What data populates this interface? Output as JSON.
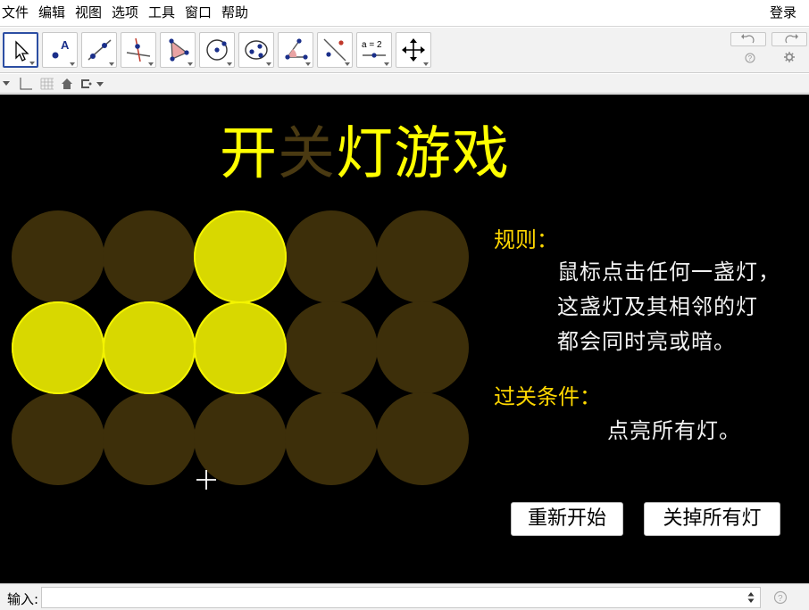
{
  "menubar": {
    "items": [
      "文件",
      "编辑",
      "视图",
      "选项",
      "工具",
      "窗口",
      "帮助"
    ],
    "login": "登录"
  },
  "toolbar": {
    "tools": [
      {
        "name": "move-tool-icon"
      },
      {
        "name": "point-tool-icon",
        "label": "A"
      },
      {
        "name": "line-tool-icon"
      },
      {
        "name": "perpendicular-line-tool-icon"
      },
      {
        "name": "polygon-tool-icon"
      },
      {
        "name": "circle-tool-icon"
      },
      {
        "name": "ellipse-tool-icon"
      },
      {
        "name": "angle-tool-icon"
      },
      {
        "name": "reflect-tool-icon"
      },
      {
        "name": "slider-tool-icon",
        "label": "a = 2"
      },
      {
        "name": "move-view-tool-icon"
      }
    ]
  },
  "canvas": {
    "title_chars": [
      {
        "char": "开",
        "color": "#ffff00"
      },
      {
        "char": "关",
        "color": "#4a3a12"
      },
      {
        "char": "灯",
        "color": "#ffff00"
      },
      {
        "char": "游",
        "color": "#ffff00"
      },
      {
        "char": "戏",
        "color": "#ffff00"
      }
    ],
    "lamps": [
      [
        false,
        false,
        true,
        false,
        false
      ],
      [
        true,
        true,
        true,
        false,
        false
      ],
      [
        false,
        false,
        false,
        false,
        false
      ]
    ],
    "colors": {
      "lamp_on": "#d8d800",
      "lamp_on_border": "#f5f500",
      "lamp_off": "#3d2f0a",
      "heading": "#ffd700",
      "text": "#f2f2f2"
    },
    "rules_heading": "规则：",
    "rules_lines": [
      "鼠标点击任何一盏灯，",
      "这盏灯及其相邻的灯",
      "都会同时亮或暗。"
    ],
    "win_heading": "过关条件：",
    "win_text": "点亮所有灯。",
    "restart_button": "重新开始",
    "all_off_button": "关掉所有灯"
  },
  "inputbar": {
    "label": "输入:"
  }
}
